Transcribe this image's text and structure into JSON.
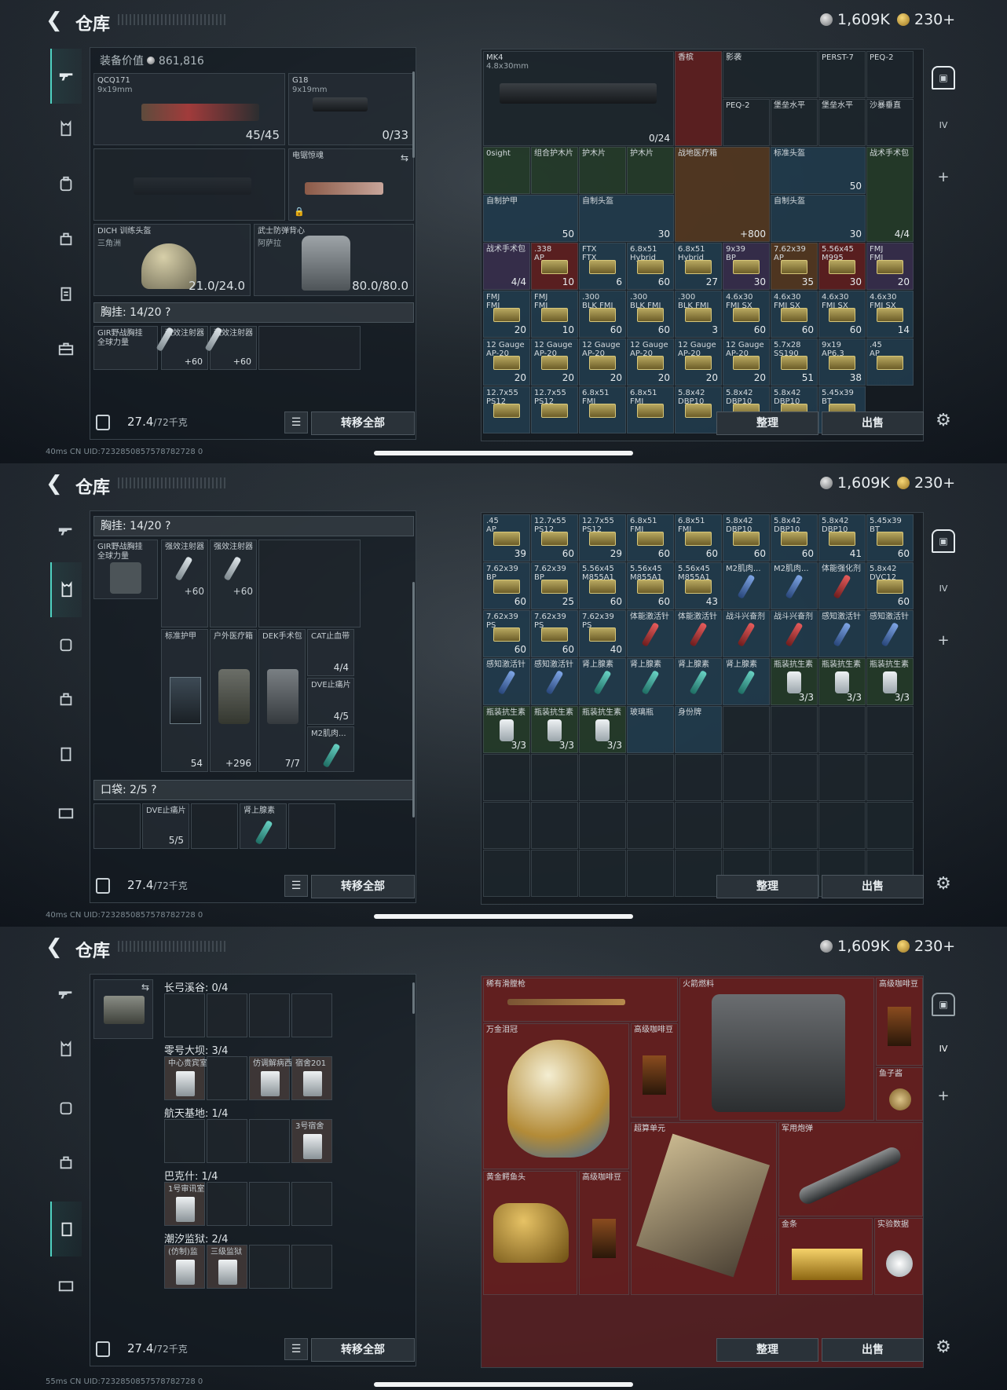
{
  "app": {
    "title": "仓库",
    "silver": "1,609K",
    "gold": "230+"
  },
  "s1": {
    "equip_value_label": "装备价值",
    "equip_value": "861,816",
    "primary": {
      "name": "QCQ171",
      "cal": "9x19mm",
      "ammo": "45/45"
    },
    "secondary": {
      "name": "G18",
      "cal": "9x19mm",
      "ammo": "0/33"
    },
    "melee": {
      "name": "电锯惊魂"
    },
    "helmet": {
      "name": "DICH 训练头盔",
      "sub": "三角洲",
      "dur": "21.0/24.0"
    },
    "armor": {
      "name": "武士防弹背心",
      "sub": "阿萨拉",
      "dur": "80.0/80.0"
    },
    "rig_header": "胸挂: 14/20 ?",
    "rig_row": [
      {
        "name": "GIR野战胸挂\n全球力量"
      },
      {
        "name": "强效注射器",
        "q": "+60"
      },
      {
        "name": "强效注射器",
        "q": "+60"
      }
    ],
    "stash_top": {
      "name": "MK4",
      "sub": "4.8x30mm",
      "q": "0/24"
    },
    "stash_items": [
      {
        "n": "香槟",
        "c": "red"
      },
      {
        "n": "影袭",
        "c": "dark"
      },
      {
        "n": "PERST-7",
        "c": "dark"
      },
      {
        "n": "PEQ-2",
        "c": "dark"
      },
      {
        "n": "PEQ-2",
        "c": "dark"
      },
      {
        "n": "堡垒水平",
        "c": "dark"
      },
      {
        "n": "堡垒水平",
        "c": "dark"
      },
      {
        "n": "沙暴垂直",
        "c": "dark"
      },
      {
        "n": "0sight",
        "c": "green"
      },
      {
        "n": "组合护木片",
        "c": "green"
      },
      {
        "n": "护木片",
        "c": "green"
      },
      {
        "n": "护木片",
        "c": "green"
      },
      {
        "n": "战地医疗箱",
        "c": "orange",
        "q": "+800"
      },
      {
        "n": "标准头盔",
        "c": "blue",
        "q": "50"
      },
      {
        "n": "战术手术包",
        "c": "green",
        "q": "4/4"
      },
      {
        "n": "自制护甲",
        "c": "blue",
        "q": "50"
      },
      {
        "n": "自制头盔",
        "c": "blue",
        "q": "30"
      },
      {
        "n": "自制头盔",
        "c": "blue",
        "q": "30"
      },
      {
        "n": "战术手术包",
        "c": "purple",
        "q": "4/4"
      },
      {
        "n": ".338\nAP",
        "c": "red",
        "q": "10"
      },
      {
        "n": "FTX\nFTX",
        "c": "blue",
        "q": "6"
      },
      {
        "n": "6.8x51\nHybrid",
        "c": "blue",
        "q": "60"
      },
      {
        "n": "6.8x51\nHybrid",
        "c": "blue",
        "q": "27"
      },
      {
        "n": "9x39\nBP",
        "c": "purple",
        "q": "30"
      },
      {
        "n": "7.62x39\nAP",
        "c": "orange",
        "q": "35"
      },
      {
        "n": "5.56x45\nM995",
        "c": "red",
        "q": "30"
      },
      {
        "n": "FMJ\nFMJ",
        "c": "purple",
        "q": "20"
      },
      {
        "n": "FMJ\nFMJ",
        "c": "blue",
        "q": "20"
      },
      {
        "n": "FMJ\nFMJ",
        "c": "blue",
        "q": "10"
      },
      {
        "n": ".300\nBLK FMJ",
        "c": "blue",
        "q": "60"
      },
      {
        "n": ".300\nBLK FMJ",
        "c": "blue",
        "q": "60"
      },
      {
        "n": ".300\nBLK FMJ",
        "c": "blue",
        "q": "3"
      },
      {
        "n": "4.6x30\nFMJ SX",
        "c": "blue",
        "q": "60"
      },
      {
        "n": "4.6x30\nFMJ SX",
        "c": "blue",
        "q": "60"
      },
      {
        "n": "4.6x30\nFMJ SX",
        "c": "blue",
        "q": "60"
      },
      {
        "n": "4.6x30\nFMJ SX",
        "c": "blue",
        "q": "14"
      },
      {
        "n": "12 Gauge\nAP-20",
        "c": "blue",
        "q": "20"
      },
      {
        "n": "12 Gauge\nAP-20",
        "c": "blue",
        "q": "20"
      },
      {
        "n": "12 Gauge\nAP-20",
        "c": "blue",
        "q": "20"
      },
      {
        "n": "12 Gauge\nAP-20",
        "c": "blue",
        "q": "20"
      },
      {
        "n": "12 Gauge\nAP-20",
        "c": "blue",
        "q": "20"
      },
      {
        "n": "12 Gauge\nAP-20",
        "c": "blue",
        "q": "20"
      },
      {
        "n": "5.7x28\nSS190",
        "c": "blue",
        "q": "51"
      },
      {
        "n": "9x19\nAP6.3",
        "c": "blue",
        "q": "38"
      },
      {
        "n": ".45\nAP",
        "c": "blue",
        "q": ""
      },
      {
        "n": "12.7x55\nPS12",
        "c": "blue",
        "q": ""
      },
      {
        "n": "12.7x55\nPS12",
        "c": "blue",
        "q": ""
      },
      {
        "n": "6.8x51\nFMJ",
        "c": "blue",
        "q": ""
      },
      {
        "n": "6.8x51\nFMJ",
        "c": "blue",
        "q": ""
      },
      {
        "n": "5.8x42\nDBP10",
        "c": "blue",
        "q": ""
      },
      {
        "n": "5.8x42\nDBP10",
        "c": "blue",
        "q": ""
      },
      {
        "n": "5.8x42\nDBP10",
        "c": "blue",
        "q": ""
      },
      {
        "n": "5.45x39\nBT",
        "c": "blue",
        "q": ""
      }
    ]
  },
  "s2": {
    "rig_header": "胸挂: 14/20 ?",
    "rig_name": "GIR野战胸挂\n全球力量",
    "injectors": [
      {
        "n": "强效注射器",
        "q": "+60"
      },
      {
        "n": "强效注射器",
        "q": "+60"
      }
    ],
    "meds": [
      {
        "n": "标准护甲",
        "q": "54"
      },
      {
        "n": "户外医疗箱",
        "q": "+296"
      },
      {
        "n": "DEK手术包",
        "q": "7/7"
      }
    ],
    "side": [
      {
        "n": "CAT止血带",
        "q": "4/4"
      },
      {
        "n": "DVE止痛片",
        "q": "4/5"
      },
      {
        "n": "M2肌肉...",
        "q": ""
      }
    ],
    "pocket_header": "口袋: 2/5 ?",
    "pockets": [
      {
        "n": "DVE止痛片",
        "q": "5/5"
      },
      {
        "n": "肾上腺素",
        "q": ""
      }
    ],
    "stash_rows": [
      [
        {
          "n": ".45\nAP",
          "q": "39"
        },
        {
          "n": "12.7x55\nPS12",
          "q": "60"
        },
        {
          "n": "12.7x55\nPS12",
          "q": "29"
        },
        {
          "n": "6.8x51\nFMJ",
          "q": "60"
        },
        {
          "n": "6.8x51\nFMJ",
          "q": "60"
        },
        {
          "n": "5.8x42\nDBP10",
          "q": "60"
        },
        {
          "n": "5.8x42\nDBP10",
          "q": "60"
        },
        {
          "n": "5.8x42\nDBP10",
          "q": "41"
        },
        {
          "n": "5.45x39\nBT",
          "q": "60"
        }
      ],
      [
        {
          "n": "7.62x39\nBP",
          "q": "60"
        },
        {
          "n": "7.62x39\nBP",
          "q": "25"
        },
        {
          "n": "5.56x45\nM855A1",
          "q": "60"
        },
        {
          "n": "5.56x45\nM855A1",
          "q": "60"
        },
        {
          "n": "5.56x45\nM855A1",
          "q": "43"
        },
        {
          "n": "M2肌肉...",
          "q": ""
        },
        {
          "n": "M2肌肉...",
          "q": ""
        },
        {
          "n": "体能强化剂",
          "q": ""
        },
        {
          "n": "5.8x42\nDVC12",
          "q": "60"
        }
      ],
      [
        {
          "n": "7.62x39\nPS",
          "q": "60"
        },
        {
          "n": "7.62x39\nPS",
          "q": "60"
        },
        {
          "n": "7.62x39\nPS",
          "q": "40"
        },
        {
          "n": "体能激活针",
          "q": ""
        },
        {
          "n": "体能激活针",
          "q": ""
        },
        {
          "n": "战斗兴奋剂",
          "q": ""
        },
        {
          "n": "战斗兴奋剂",
          "q": ""
        },
        {
          "n": "感知激活针",
          "q": ""
        },
        {
          "n": "感知激活针",
          "q": ""
        }
      ],
      [
        {
          "n": "感知激活针",
          "q": ""
        },
        {
          "n": "感知激活针",
          "q": ""
        },
        {
          "n": "肾上腺素",
          "q": ""
        },
        {
          "n": "肾上腺素",
          "q": ""
        },
        {
          "n": "肾上腺素",
          "q": ""
        },
        {
          "n": "肾上腺素",
          "q": ""
        },
        {
          "n": "瓶装抗生素",
          "q": "3/3"
        },
        {
          "n": "瓶装抗生素",
          "q": "3/3"
        },
        {
          "n": "瓶装抗生素",
          "q": "3/3"
        }
      ],
      [
        {
          "n": "瓶装抗生素",
          "q": "3/3"
        },
        {
          "n": "瓶装抗生素",
          "q": "3/3"
        },
        {
          "n": "瓶装抗生素",
          "q": "3/3"
        },
        {
          "n": "玻璃瓶",
          "q": ""
        },
        {
          "n": "身份牌",
          "q": ""
        }
      ]
    ]
  },
  "s3": {
    "key_sections": [
      {
        "h": "长弓溪谷: 0/4",
        "items": []
      },
      {
        "h": "零号大坝: 3/4",
        "items": [
          "中心贵宾室",
          "",
          "仿调解病西",
          "宿舍201"
        ]
      },
      {
        "h": "航天基地: 1/4",
        "items": [
          "",
          "",
          "",
          "3号宿舍"
        ]
      },
      {
        "h": "巴克什: 1/4",
        "items": [
          "1号审讯室",
          "",
          "",
          ""
        ]
      },
      {
        "h": "潮汐监狱: 2/4",
        "items": [
          "(仿制)监",
          "三级监狱",
          "",
          ""
        ]
      }
    ],
    "collectibles": [
      {
        "n": "稀有滑膛枪"
      },
      {
        "n": "火箭燃料"
      },
      {
        "n": "高级咖啡豆"
      },
      {
        "n": "万金泪冠"
      },
      {
        "n": "高级咖啡豆"
      },
      {
        "n": "鱼子酱"
      },
      {
        "n": "超算单元"
      },
      {
        "n": "军用炮弹"
      },
      {
        "n": "黄金鳄鱼头"
      },
      {
        "n": "高级咖啡豆"
      },
      {
        "n": "金条"
      },
      {
        "n": "实验数据"
      }
    ]
  },
  "footer": {
    "weight": "27.4",
    "weight_max": "/72千克",
    "transfer_all": "转移全部",
    "sort": "整理",
    "sell": "出售"
  },
  "status": {
    "s1": "40ms",
    "s2": "40ms",
    "s3": "55ms",
    "uid": "CN UID:7232850857578782728 0"
  }
}
